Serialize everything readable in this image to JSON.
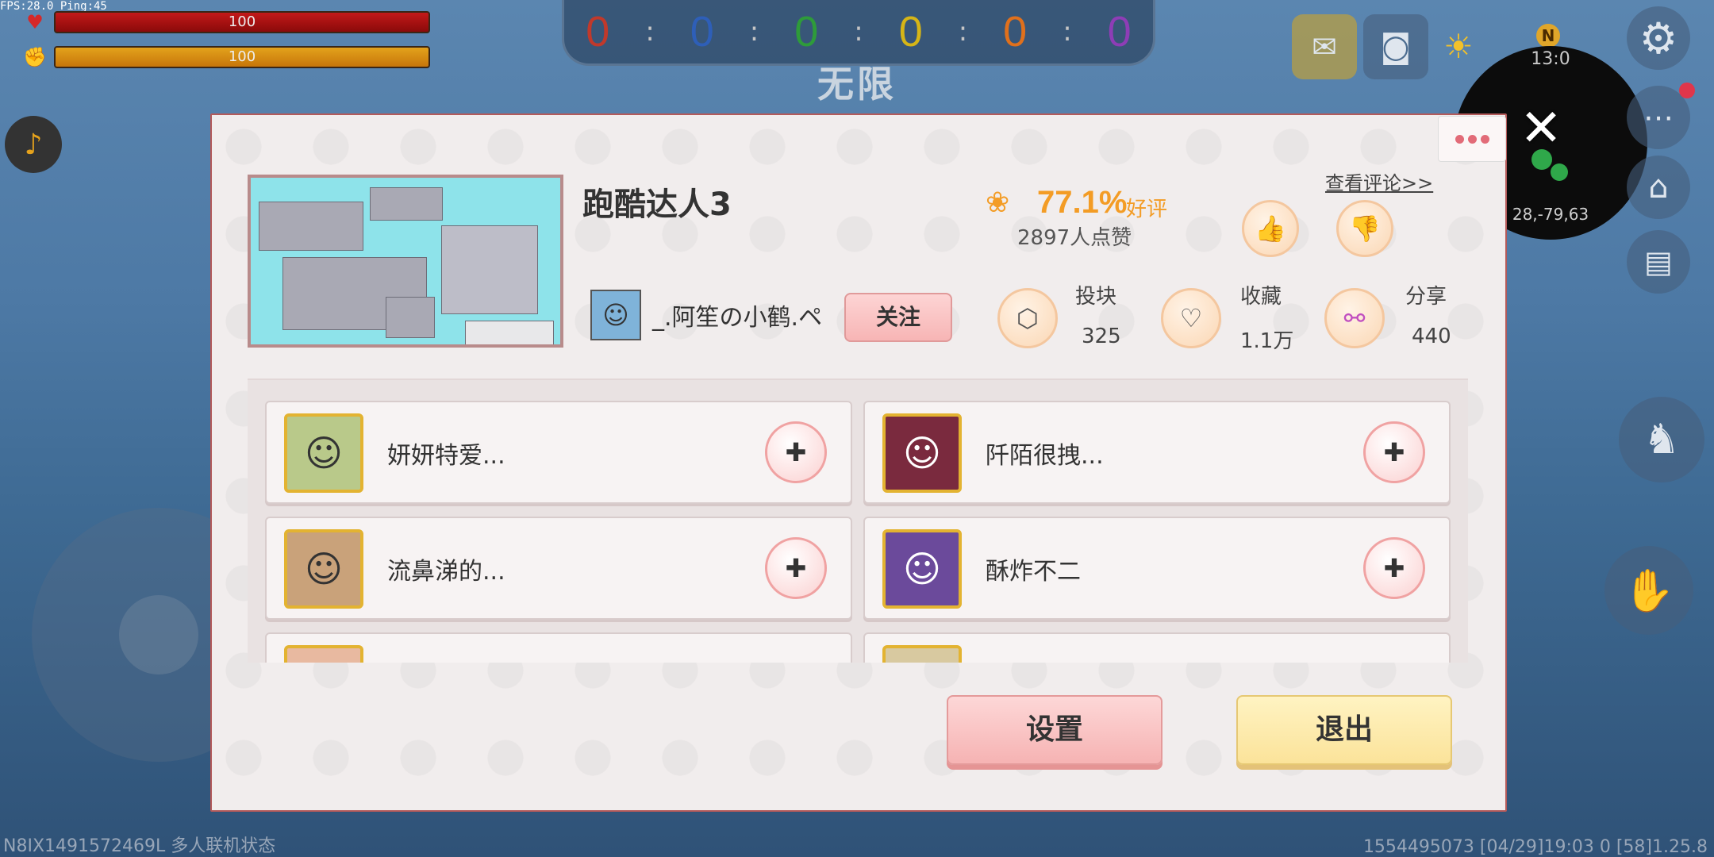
{
  "hud": {
    "fps_text": "FPS:28.0  Ping:45",
    "health": "100",
    "hunger": "100",
    "scores": [
      {
        "value": "0",
        "color": "#c0392b"
      },
      {
        "value": "0",
        "color": "#2e5fb8"
      },
      {
        "value": "0",
        "color": "#2e9b3a"
      },
      {
        "value": "0",
        "color": "#d6b516"
      },
      {
        "value": "0",
        "color": "#e0701c"
      },
      {
        "value": "0",
        "color": "#8e3db6"
      }
    ],
    "score_separator": ":",
    "mode": "无限",
    "minimap_time": "13:0",
    "minimap_coord": "28,-79,63",
    "compass": "N",
    "bottom_left": "N8IX1491572469L 多人联机状态",
    "bottom_right": "1554495073   [04/29]19:03 0   [58]1.25.8"
  },
  "dialog": {
    "map_title": "跑酷达人3",
    "author_name": "_.阿笙の小鹤.ペ",
    "follow_label": "关注",
    "rating_percent": "77.1%",
    "rating_word": "好评",
    "likes_count": "2897人点赞",
    "view_comments": "查看评论>>",
    "stats": [
      {
        "label": "投块",
        "value": "325",
        "icon": "cube-icon"
      },
      {
        "label": "收藏",
        "value": "1.1万",
        "icon": "heart-icon"
      },
      {
        "label": "分享",
        "value": "440",
        "icon": "share-icon"
      }
    ],
    "players": [
      {
        "name": "妍妍特爱..."
      },
      {
        "name": "阡陌很拽..."
      },
      {
        "name": "流鼻涕的..."
      },
      {
        "name": "酥炸不二"
      }
    ],
    "settings_label": "设置",
    "exit_label": "退出"
  }
}
